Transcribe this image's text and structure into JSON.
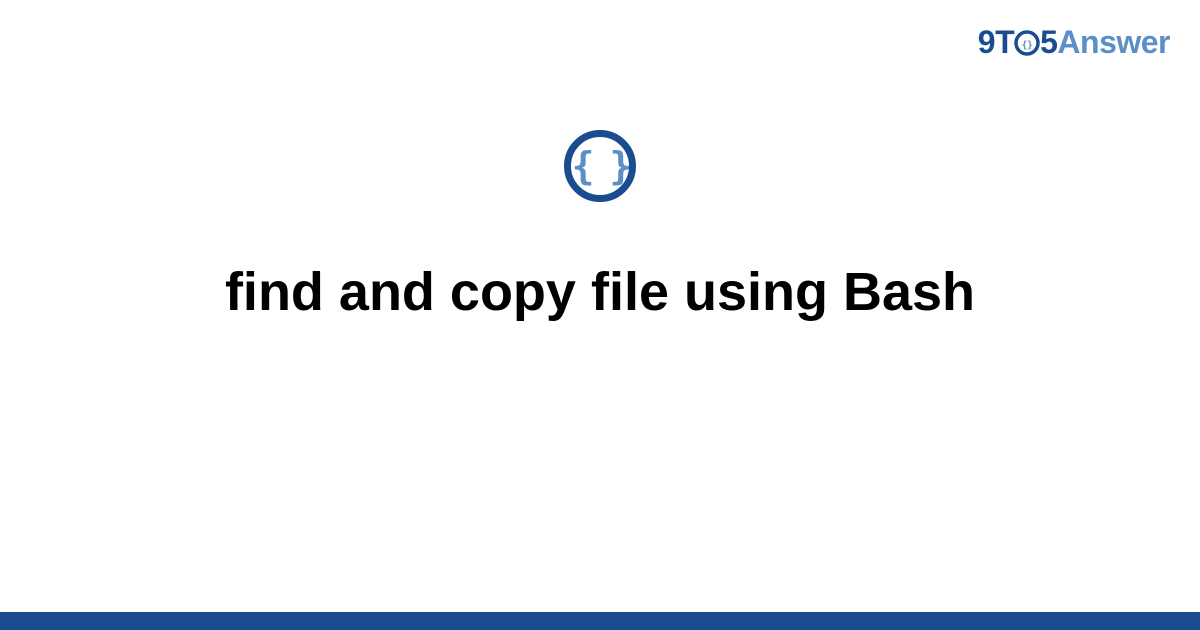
{
  "logo": {
    "part1": "9T",
    "part2": "5",
    "part3": "Answer"
  },
  "title": "find and copy file using Bash",
  "colors": {
    "brand_dark": "#1a4d8f",
    "brand_light": "#5b8fc7"
  }
}
